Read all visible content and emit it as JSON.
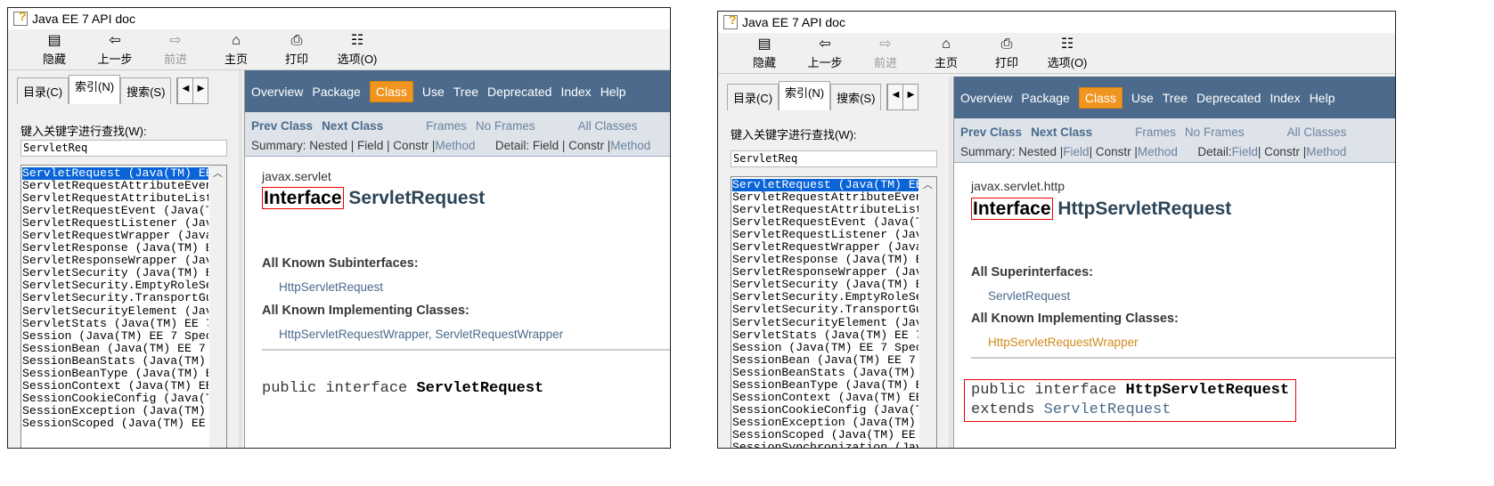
{
  "windows": [
    {
      "title": "Java EE 7 API doc",
      "toolbar": [
        {
          "icon": "hide-icon",
          "glyph": "▤",
          "label": "隐藏",
          "disabled": false
        },
        {
          "icon": "back-icon",
          "glyph": "⇦",
          "label": "上一步",
          "disabled": false
        },
        {
          "icon": "forward-icon",
          "glyph": "⇨",
          "label": "前进",
          "disabled": true
        },
        {
          "icon": "home-icon",
          "glyph": "⌂",
          "label": "主页",
          "disabled": false
        },
        {
          "icon": "print-icon",
          "glyph": "⎙",
          "label": "打印",
          "disabled": false
        },
        {
          "icon": "options-icon",
          "glyph": "☷",
          "label": "选项(O)",
          "disabled": false
        }
      ],
      "tabs": [
        "目录(C)",
        "索引(N)",
        "搜索(S)"
      ],
      "active_tab": 1,
      "keyword_label": "键入关键字进行查找(W):",
      "keyword_value": "ServletReq",
      "index_items": [
        "ServletRequest (Java(TM) EE",
        "ServletRequestAttributeEvent",
        "ServletRequestAttributeListe",
        "ServletRequestEvent (Java(TM",
        "ServletRequestListener (Java",
        "ServletRequestWrapper (Java(",
        "ServletResponse (Java(TM) EE",
        "ServletResponseWrapper (Java",
        "ServletSecurity (Java(TM) EE",
        "ServletSecurity.EmptyRoleSem",
        "ServletSecurity.TransportGua",
        "ServletSecurityElement (Java",
        "ServletStats (Java(TM) EE 7 ",
        "Session (Java(TM) EE 7 Speci",
        "SessionBean (Java(TM) EE 7 S",
        "SessionBeanStats (Java(TM) E",
        "SessionBeanType (Java(TM) EE",
        "SessionContext (Java(TM) EE ",
        "SessionCookieConfig (Java(TM",
        "SessionException (Java(TM) E",
        "SessionScoped (Java(TM) EE 7"
      ],
      "selected_index": 0,
      "nav": [
        "Overview",
        "Package",
        "Class",
        "Use",
        "Tree",
        "Deprecated",
        "Index",
        "Help"
      ],
      "nav_current": "Class",
      "subnav": {
        "prev": "Prev Class",
        "next": "Next Class",
        "frames": "Frames",
        "noframes": "No Frames",
        "all": "All Classes",
        "summary": "Summary: Nested | Field | Constr | ",
        "summary_link": "Method",
        "detail": "Detail: Field | Constr | ",
        "detail_link": "Method"
      },
      "package": "javax.servlet",
      "title_kw": "Interface",
      "title_name": "ServletRequest",
      "sections": [
        {
          "heading": "All Known Subinterfaces:",
          "value": "HttpServletRequest",
          "color": "blue"
        },
        {
          "heading": "All Known Implementing Classes:",
          "value": "HttpServletRequestWrapper, ServletRequestWrapper",
          "color": "blue"
        }
      ],
      "signature": {
        "prefix": "public interface ",
        "name": "ServletRequest",
        "extends_kw": "",
        "extends_name": ""
      }
    },
    {
      "title": "Java EE 7 API doc",
      "toolbar": [
        {
          "icon": "hide-icon",
          "glyph": "▤",
          "label": "隐藏",
          "disabled": false
        },
        {
          "icon": "back-icon",
          "glyph": "⇦",
          "label": "上一步",
          "disabled": false
        },
        {
          "icon": "forward-icon",
          "glyph": "⇨",
          "label": "前进",
          "disabled": true
        },
        {
          "icon": "home-icon",
          "glyph": "⌂",
          "label": "主页",
          "disabled": false
        },
        {
          "icon": "print-icon",
          "glyph": "⎙",
          "label": "打印",
          "disabled": false
        },
        {
          "icon": "options-icon",
          "glyph": "☷",
          "label": "选项(O)",
          "disabled": false
        }
      ],
      "tabs": [
        "目录(C)",
        "索引(N)",
        "搜索(S)"
      ],
      "active_tab": 1,
      "keyword_label": "键入关键字进行查找(W):",
      "keyword_value": "ServletReq",
      "index_items": [
        "ServletRequest (Java(TM) EE",
        "ServletRequestAttributeEvent",
        "ServletRequestAttributeListe",
        "ServletRequestEvent (Java(TM",
        "ServletRequestListener (Java",
        "ServletRequestWrapper (Java(",
        "ServletResponse (Java(TM) EE",
        "ServletResponseWrapper (Java",
        "ServletSecurity (Java(TM) EE",
        "ServletSecurity.EmptyRoleSem",
        "ServletSecurity.TransportGua",
        "ServletSecurityElement (Java",
        "ServletStats (Java(TM) EE 7 ",
        "Session (Java(TM) EE 7 Speci",
        "SessionBean (Java(TM) EE 7 S",
        "SessionBeanStats (Java(TM) E",
        "SessionBeanType (Java(TM) EE",
        "SessionContext (Java(TM) EE ",
        "SessionCookieConfig (Java(TM",
        "SessionException (Java(TM) E",
        "SessionScoped (Java(TM) EE 7",
        "SessionSynchronization (Java"
      ],
      "selected_index": 0,
      "nav": [
        "Overview",
        "Package",
        "Class",
        "Use",
        "Tree",
        "Deprecated",
        "Index",
        "Help"
      ],
      "nav_current": "Class",
      "subnav": {
        "prev": "Prev Class",
        "next": "Next Class",
        "frames": "Frames",
        "noframes": "No Frames",
        "all": "All Classes",
        "summary": "Summary: Nested | ",
        "summary_link": "Field",
        "summary2": " | Constr | ",
        "summary_link2": "Method",
        "detail": "Detail: ",
        "detail_link": "Field",
        "detail2": " | Constr | ",
        "detail_link2": "Method"
      },
      "package": "javax.servlet.http",
      "title_kw": "Interface",
      "title_name": "HttpServletRequest",
      "sections": [
        {
          "heading": "All Superinterfaces:",
          "value": "ServletRequest",
          "color": "blue"
        },
        {
          "heading": "All Known Implementing Classes:",
          "value": "HttpServletRequestWrapper",
          "color": "orange"
        }
      ],
      "signature": {
        "prefix": "public interface ",
        "name": "HttpServletRequest",
        "extends_kw": "extends ",
        "extends_name": "ServletRequest"
      }
    }
  ]
}
